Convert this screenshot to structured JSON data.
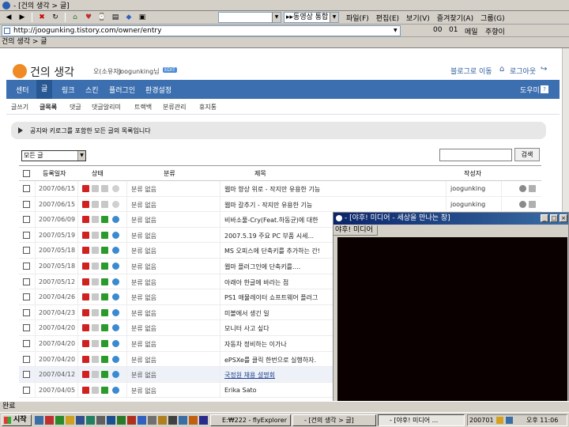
{
  "window": {
    "title": "- [건의 생각 > 글]"
  },
  "toolbar": {
    "search_combo": "",
    "media_combo": "▸▸동영상 통합",
    "menus": [
      "파일(F)",
      "편집(E)",
      "보기(V)",
      "즐겨찾기(A)",
      "그룹(G)"
    ],
    "links": [
      "00",
      "01",
      "메일",
      "주향이"
    ]
  },
  "address": {
    "url": "http://joogunking.tistory.com/owner/entry"
  },
  "breadcrumb": "건의 생각 > 글",
  "blog": {
    "name": "건의 생각",
    "owner_label": "오(소유자)",
    "user": "joogunking님",
    "edit_badge": "EDIT",
    "go_blog": "블로그로 이동",
    "logout": "로그아웃",
    "help": "도우미"
  },
  "nav": [
    "센터",
    "글",
    "링크",
    "스킨",
    "플러그인",
    "환경설정"
  ],
  "subnav": [
    "글쓰기",
    "글목록",
    "댓글",
    "댓글알리미",
    "트랙백",
    "분류관리",
    "휴지통"
  ],
  "notice": "공지와 키로그를 포함한 모든 글의 목록입니다",
  "filter": {
    "selected": "모든 글",
    "search_button": "검색"
  },
  "table": {
    "headers": [
      "등록일자",
      "상태",
      "분류",
      "제목",
      "작성자"
    ],
    "rows": [
      {
        "date": "2007/06/15",
        "category": "분류 없음",
        "title": "웹마 향상 위로 - 작지만 유용한 기능",
        "author": "joogunking"
      },
      {
        "date": "2007/06/15",
        "category": "분류 없음",
        "title": "웹마 갈추기 - 작지만 유용한 기능",
        "author": "joogunking"
      },
      {
        "date": "2007/06/09",
        "category": "분류 없음",
        "title": "비바소풀-Cry(Feat.하동균)에 대한",
        "author": ""
      },
      {
        "date": "2007/05/19",
        "category": "분류 없음",
        "title": "2007.5.19 주요 PC 부품 시세...",
        "author": ""
      },
      {
        "date": "2007/05/18",
        "category": "분류 없음",
        "title": "MS 오피스에 단축키를 추가하는 간!",
        "author": ""
      },
      {
        "date": "2007/05/18",
        "category": "분류 없음",
        "title": "웹마 플러그인에 단축키를....",
        "author": ""
      },
      {
        "date": "2007/05/12",
        "category": "분류 없음",
        "title": "아래아 한글에 바라는 점",
        "author": ""
      },
      {
        "date": "2007/04/26",
        "category": "분류 없음",
        "title": "PS1 애뮬레이터 쇼프트웨어 플러그",
        "author": ""
      },
      {
        "date": "2007/04/23",
        "category": "분류 없음",
        "title": "미볼에서 생긴 일",
        "author": ""
      },
      {
        "date": "2007/04/20",
        "category": "분류 없음",
        "title": "모니터 사고 싶다",
        "author": ""
      },
      {
        "date": "2007/04/20",
        "category": "분류 없음",
        "title": "자동차 정비하는 이가나",
        "author": ""
      },
      {
        "date": "2007/04/20",
        "category": "분류 없음",
        "title": "ePSXe를 클릭 한번으로 실행하자.",
        "author": ""
      },
      {
        "date": "2007/04/12",
        "category": "분류 없음",
        "title": "국정원 채용 설명회",
        "author": ""
      },
      {
        "date": "2007/04/05",
        "category": "분류 없음",
        "title": "Erika Sato",
        "author": ""
      }
    ]
  },
  "media": {
    "title": "- [야후! 미디어 - 세상을 만나는 창]",
    "tab": "야후! 미디어"
  },
  "status": "완료",
  "taskbar": {
    "start": "시작",
    "tasks": [
      "E:₩222 - flyExplorer",
      "- [건의 생각 > 글]",
      "- [야후! 미디어 ..."
    ],
    "tray_text": "200701",
    "clock": "오후 11:06"
  }
}
